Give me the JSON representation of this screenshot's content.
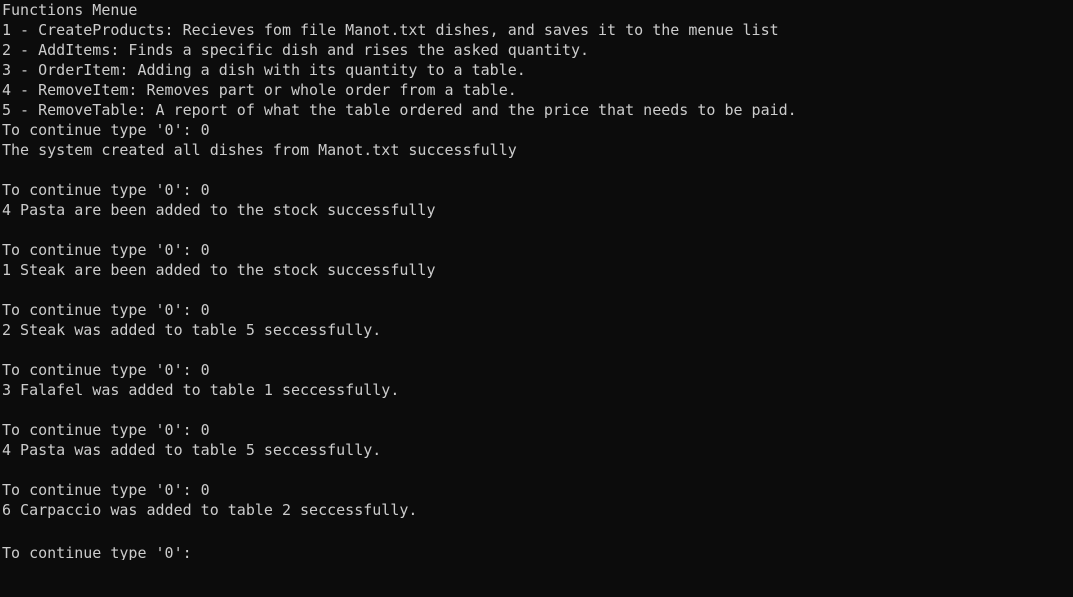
{
  "console": {
    "lines": [
      "Functions Menue",
      "1 - CreateProducts: Recieves fom file Manot.txt dishes, and saves it to the menue list",
      "2 - AddItems: Finds a specific dish and rises the asked quantity.",
      "3 - OrderItem: Adding a dish with its quantity to a table.",
      "4 - RemoveItem: Removes part or whole order from a table.",
      "5 - RemoveTable: A report of what the table ordered and the price that needs to be paid.",
      "To continue type '0': 0",
      "The system created all dishes from Manot.txt successfully",
      "",
      "To continue type '0': 0",
      "4 Pasta are been added to the stock successfully",
      "",
      "To continue type '0': 0",
      "1 Steak are been added to the stock successfully",
      "",
      "To continue type '0': 0",
      "2 Steak was added to table 5 seccessfully.",
      "",
      "To continue type '0': 0",
      "3 Falafel was added to table 1 seccessfully.",
      "",
      "To continue type '0': 0",
      "4 Pasta was added to table 5 seccessfully.",
      "",
      "To continue type '0': 0",
      "6 Carpaccio was added to table 2 seccessfully.",
      "",
      "To continue type '0':"
    ]
  }
}
